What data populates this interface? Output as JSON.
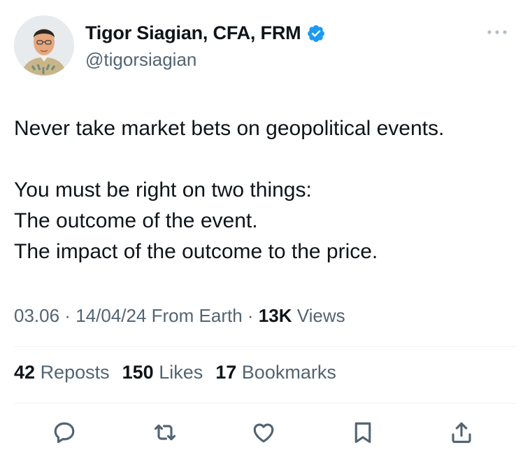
{
  "tweet": {
    "author": {
      "name": "Tigor Siagian, CFA, FRM",
      "handle": "@tigorsiagian",
      "verified": true
    },
    "body": {
      "line1": "Never take market bets on geopolitical events.",
      "line2": "You must be right on two things:",
      "line3": "The outcome of the event.",
      "line4": "The impact of the outcome to the price."
    },
    "meta": {
      "time": "03.06",
      "separator": " · ",
      "date": "14/04/24",
      "source": "From Earth",
      "views_count": "13K",
      "views_label": "Views"
    },
    "stats": {
      "reposts_count": "42",
      "reposts_label": "Reposts",
      "likes_count": "150",
      "likes_label": "Likes",
      "bookmarks_count": "17",
      "bookmarks_label": "Bookmarks"
    },
    "icons": {
      "more": "more-icon",
      "reply": "reply-icon",
      "repost": "repost-icon",
      "like": "like-icon",
      "bookmark": "bookmark-icon",
      "share": "share-icon"
    },
    "colors": {
      "verified": "#1d9bf0",
      "secondary_text": "#536471",
      "primary_text": "#0f1419"
    }
  }
}
